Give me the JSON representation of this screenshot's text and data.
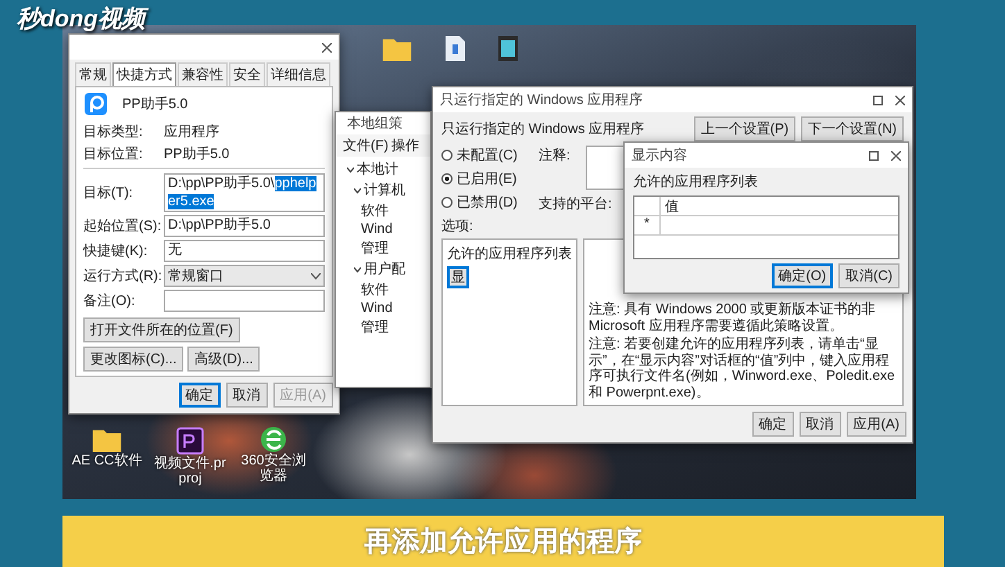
{
  "logo": {
    "text": "秒dong视频"
  },
  "desktop_icons": [
    {
      "kind": "folder"
    },
    {
      "kind": "file"
    },
    {
      "kind": "video"
    },
    {
      "kind": "folder",
      "label": "AE CC软件"
    },
    {
      "kind": "premiere",
      "label": "视频文件.prproj"
    },
    {
      "kind": "browser",
      "label": "360安全浏览器"
    }
  ],
  "properties_dialog": {
    "tabs": [
      {
        "label": "常规",
        "selected": false
      },
      {
        "label": "快捷方式",
        "selected": true
      },
      {
        "label": "兼容性",
        "selected": false
      },
      {
        "label": "安全",
        "selected": false
      },
      {
        "label": "详细信息",
        "selected": false
      }
    ],
    "app_name": "PP助手5.0",
    "info": [
      {
        "label": "目标类型:",
        "value": "应用程序"
      },
      {
        "label": "目标位置:",
        "value": "PP助手5.0"
      }
    ],
    "fields": [
      {
        "kind": "input",
        "label": "目标(T):",
        "value": "D:\\pp\\PP助手5.0\\",
        "selection": "pphelper5.exe"
      },
      {
        "kind": "input",
        "label": "起始位置(S):",
        "value": "D:\\pp\\PP助手5.0"
      },
      {
        "kind": "input",
        "label": "快捷键(K):",
        "value": "无"
      },
      {
        "kind": "select",
        "label": "运行方式(R):",
        "value": "常规窗口"
      },
      {
        "kind": "input",
        "label": "备注(O):"
      }
    ],
    "action_buttons": [
      "打开文件所在的位置(F)",
      "更改图标(C)...",
      "高级(D)..."
    ],
    "footer_buttons": [
      {
        "label": "确定",
        "focused": true,
        "disabled": false
      },
      {
        "label": "取消",
        "focused": false,
        "disabled": false
      },
      {
        "label": "应用(A)",
        "focused": false,
        "disabled": true
      }
    ]
  },
  "policy_editor": {
    "title": "本地组策",
    "menu": [
      "文件(F)",
      "操作"
    ],
    "tree": [
      {
        "label": "本地计",
        "expanded": true,
        "children": [
          {
            "label": "计算机",
            "expanded": true,
            "children": [
              {
                "label": "软件"
              },
              {
                "label": "Wind"
              },
              {
                "label": "管理"
              }
            ]
          },
          {
            "label": "用户配",
            "expanded": true,
            "children": [
              {
                "label": "软件"
              },
              {
                "label": "Wind"
              },
              {
                "label": "管理"
              }
            ]
          }
        ]
      }
    ]
  },
  "policy_window": {
    "title": "只运行指定的 Windows 应用程序",
    "heading": "只运行指定的 Windows 应用程序",
    "nav_buttons": [
      "上一个设置(P)",
      "下一个设置(N)"
    ],
    "radios": [
      {
        "label": "未配置(C)",
        "selected": false
      },
      {
        "label": "已启用(E)",
        "selected": true
      },
      {
        "label": "已禁用(D)",
        "selected": false
      }
    ],
    "comment_label": "注释:",
    "platform_label": "支持的平台:",
    "options_label": "选项:",
    "option": {
      "label": "允许的应用程序列表",
      "button": "显"
    },
    "help_text": [
      "注意: 具有 Windows 2000 或更新版本证书的非 Microsoft 应用程序需要遵循此策略设置。",
      "注意: 若要创建允许的应用程序列表，请单击“显示”，在“显示内容”对话框的“值”列中，键入应用程序可执行文件名(例如，Winword.exe、Poledit.exe 和 Powerpnt.exe)。"
    ],
    "footer_buttons": [
      "确定",
      "取消",
      "应用(A)"
    ]
  },
  "show_contents": {
    "title": "显示内容",
    "label": "允许的应用程序列表",
    "column": "值",
    "row_marker": "*",
    "buttons": [
      {
        "label": "确定(O)",
        "focused": true
      },
      {
        "label": "取消(C)",
        "focused": false
      }
    ]
  },
  "caption": "再添加允许应用的程序"
}
